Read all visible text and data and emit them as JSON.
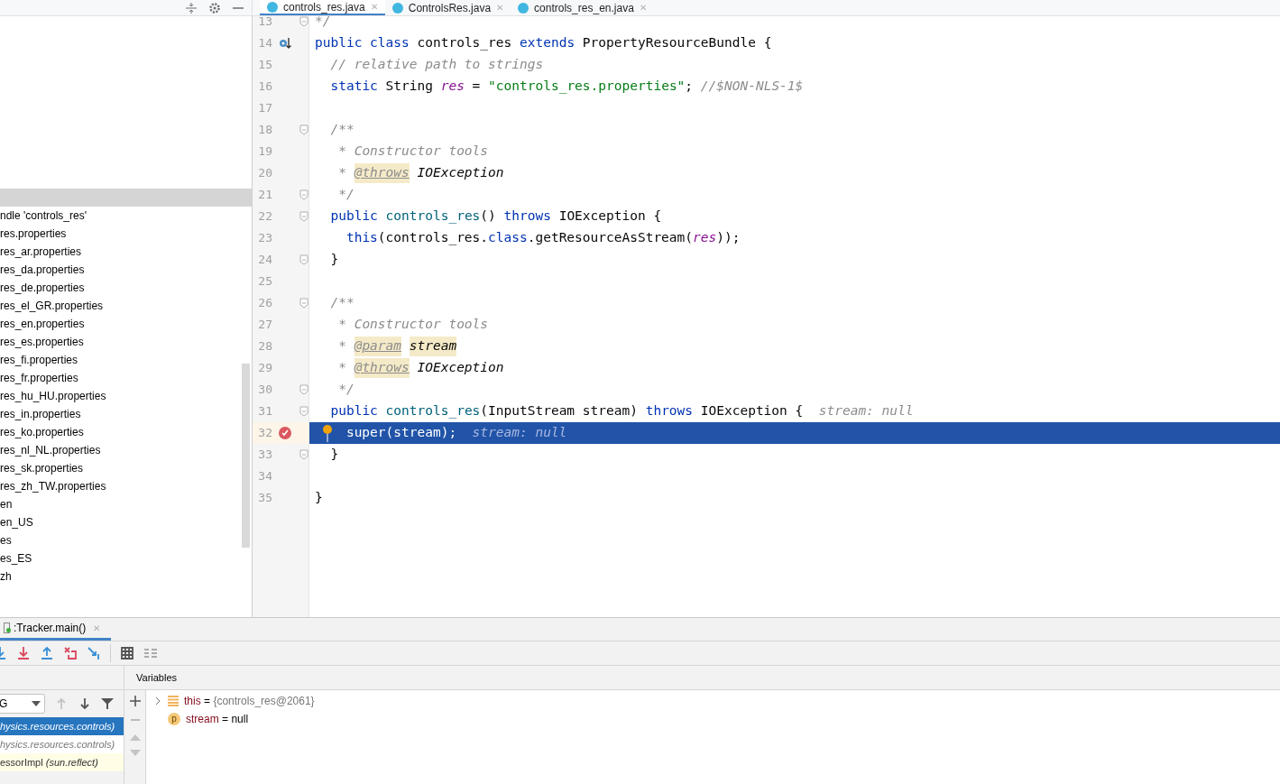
{
  "editor_tabs": [
    {
      "label": "controls_res.java",
      "selected": true,
      "close": "✕"
    },
    {
      "label": "ControlsRes.java",
      "selected": false,
      "close": "✕"
    },
    {
      "label": "controls_res_en.java",
      "selected": false,
      "close": "✕"
    }
  ],
  "project_tree": {
    "items": [
      {
        "label": "ndle 'controls_res'"
      },
      {
        "label": "res.properties"
      },
      {
        "label": "res_ar.properties"
      },
      {
        "label": "res_da.properties"
      },
      {
        "label": "res_de.properties"
      },
      {
        "label": "res_el_GR.properties"
      },
      {
        "label": "res_en.properties"
      },
      {
        "label": "res_es.properties"
      },
      {
        "label": "res_fi.properties"
      },
      {
        "label": "res_fr.properties"
      },
      {
        "label": "res_hu_HU.properties"
      },
      {
        "label": "res_in.properties"
      },
      {
        "label": "res_ko.properties"
      },
      {
        "label": "res_nl_NL.properties"
      },
      {
        "label": "res_sk.properties"
      },
      {
        "label": "res_zh_TW.properties"
      },
      {
        "label": "en"
      },
      {
        "label": "en_US"
      },
      {
        "label": "es"
      },
      {
        "label": "es_ES"
      },
      {
        "label": "zh"
      }
    ]
  },
  "code_lines": [
    {
      "number": "13",
      "fold": true,
      "current": false,
      "tokens": [
        {
          "kind": "comment",
          "text": "*/"
        }
      ]
    },
    {
      "number": "14",
      "fold": false,
      "markers": [
        {
          "kind": "override"
        }
      ],
      "current": false,
      "tokens": [
        {
          "kind": "kw",
          "text": "public class "
        },
        {
          "kind": "plain",
          "text": "controls_res "
        },
        {
          "kind": "kw",
          "text": "extends "
        },
        {
          "kind": "plain",
          "text": "PropertyResourceBundle {"
        }
      ]
    },
    {
      "number": "15",
      "fold": false,
      "current": false,
      "tokens": [
        {
          "kind": "comment",
          "text": "  // relative path to strings"
        }
      ]
    },
    {
      "number": "16",
      "fold": false,
      "current": false,
      "tokens": [
        {
          "kind": "kw",
          "text": "  static "
        },
        {
          "kind": "plain",
          "text": "String "
        },
        {
          "kind": "field",
          "text": "res"
        },
        {
          "kind": "plain",
          "text": " = "
        },
        {
          "kind": "str",
          "text": "\"controls_res.properties\""
        },
        {
          "kind": "plain",
          "text": "; "
        },
        {
          "kind": "comment",
          "text": "//$NON-NLS-1$"
        }
      ]
    },
    {
      "number": "17",
      "fold": false,
      "current": false
    },
    {
      "number": "18",
      "fold": true,
      "current": false,
      "tokens": [
        {
          "kind": "comment",
          "text": "  /**"
        }
      ]
    },
    {
      "number": "19",
      "fold": false,
      "current": false,
      "tokens": [
        {
          "kind": "comment",
          "text": "   * Constructor tools"
        }
      ]
    },
    {
      "number": "20",
      "fold": false,
      "current": false,
      "tokens": [
        {
          "kind": "comment",
          "text": "   * "
        },
        {
          "kind": "tag",
          "text": "@throws"
        },
        {
          "kind": "docref",
          "text": "IOException"
        }
      ]
    },
    {
      "number": "21",
      "fold": true,
      "current": false,
      "tokens": [
        {
          "kind": "comment",
          "text": "   */"
        }
      ]
    },
    {
      "number": "22",
      "fold": true,
      "current": false,
      "tokens": [
        {
          "kind": "kw",
          "text": "  public "
        },
        {
          "kind": "fn",
          "text": "controls_res"
        },
        {
          "kind": "plain",
          "text": "() "
        },
        {
          "kind": "kw",
          "text": "throws "
        },
        {
          "kind": "plain",
          "text": "IOException {"
        }
      ]
    },
    {
      "number": "23",
      "fold": false,
      "current": false,
      "tokens": [
        {
          "kind": "kw",
          "text": "    this"
        },
        {
          "kind": "plain",
          "text": "(controls_res."
        },
        {
          "kind": "kw",
          "text": "class"
        },
        {
          "kind": "plain",
          "text": ".getResourceAsStream("
        },
        {
          "kind": "field",
          "text": "res"
        },
        {
          "kind": "plain",
          "text": "));"
        }
      ]
    },
    {
      "number": "24",
      "fold": true,
      "current": false,
      "tokens": [
        {
          "kind": "plain",
          "text": "  }"
        }
      ]
    },
    {
      "number": "25",
      "fold": false,
      "current": false
    },
    {
      "number": "26",
      "fold": true,
      "current": false,
      "tokens": [
        {
          "kind": "comment",
          "text": "  /**"
        }
      ]
    },
    {
      "number": "27",
      "fold": false,
      "current": false,
      "tokens": [
        {
          "kind": "comment",
          "text": "   * Constructor tools"
        }
      ]
    },
    {
      "number": "28",
      "fold": false,
      "current": false,
      "tokens": [
        {
          "kind": "comment",
          "text": "   * "
        },
        {
          "kind": "tag",
          "text": "@param"
        },
        {
          "kind": "tagvalue",
          "text": "stream"
        }
      ]
    },
    {
      "number": "29",
      "fold": false,
      "current": false,
      "tokens": [
        {
          "kind": "comment",
          "text": "   * "
        },
        {
          "kind": "tag",
          "text": "@throws"
        },
        {
          "kind": "docref",
          "text": "IOException"
        }
      ]
    },
    {
      "number": "30",
      "fold": true,
      "current": false,
      "tokens": [
        {
          "kind": "comment",
          "text": "   */"
        }
      ]
    },
    {
      "number": "31",
      "fold": true,
      "current": false,
      "tokens": [
        {
          "kind": "kw",
          "text": "  public "
        },
        {
          "kind": "fn",
          "text": "controls_res"
        },
        {
          "kind": "plain",
          "text": "(InputStream stream) "
        },
        {
          "kind": "kw",
          "text": "throws "
        },
        {
          "kind": "plain",
          "text": "IOException {  "
        },
        {
          "kind": "hint",
          "text": "stream: null"
        }
      ]
    },
    {
      "number": "32",
      "fold": false,
      "markers": [
        {
          "kind": "breakpoint"
        },
        {
          "kind": "lightbulb"
        }
      ],
      "current": true,
      "tokens": [
        {
          "kind": "plain",
          "text": "super(stream);  "
        },
        {
          "kind": "hint",
          "text": "stream: null"
        }
      ]
    },
    {
      "number": "33",
      "fold": true,
      "current": false,
      "tokens": [
        {
          "kind": "plain",
          "text": "  }"
        }
      ]
    },
    {
      "number": "34",
      "fold": false,
      "current": false
    },
    {
      "number": "35",
      "fold": false,
      "current": false,
      "tokens": [
        {
          "kind": "plain",
          "text": "}"
        }
      ]
    }
  ],
  "debug": {
    "session_tab": {
      "label": ":Tracker.main()",
      "selected": true,
      "close": "✕"
    },
    "thread_dropdown": {
      "value": "G"
    },
    "frames": [
      {
        "text": "*hysics.resources.controls)*",
        "selected": true
      },
      {
        "text": "*hysics.resources.controls)*",
        "selected": false
      },
      {
        "text": "essorImpl *(sun.reflect)*",
        "selected": false
      }
    ],
    "variables_title": "Variables",
    "variables": [
      {
        "kind": "field",
        "expandable": true,
        "name": "this",
        "eq": " = ",
        "value": "{controls_res@2061}"
      },
      {
        "kind": "param",
        "expandable": false,
        "icon_letter": "p",
        "name": "stream",
        "eq": " = ",
        "value": "null"
      }
    ]
  }
}
